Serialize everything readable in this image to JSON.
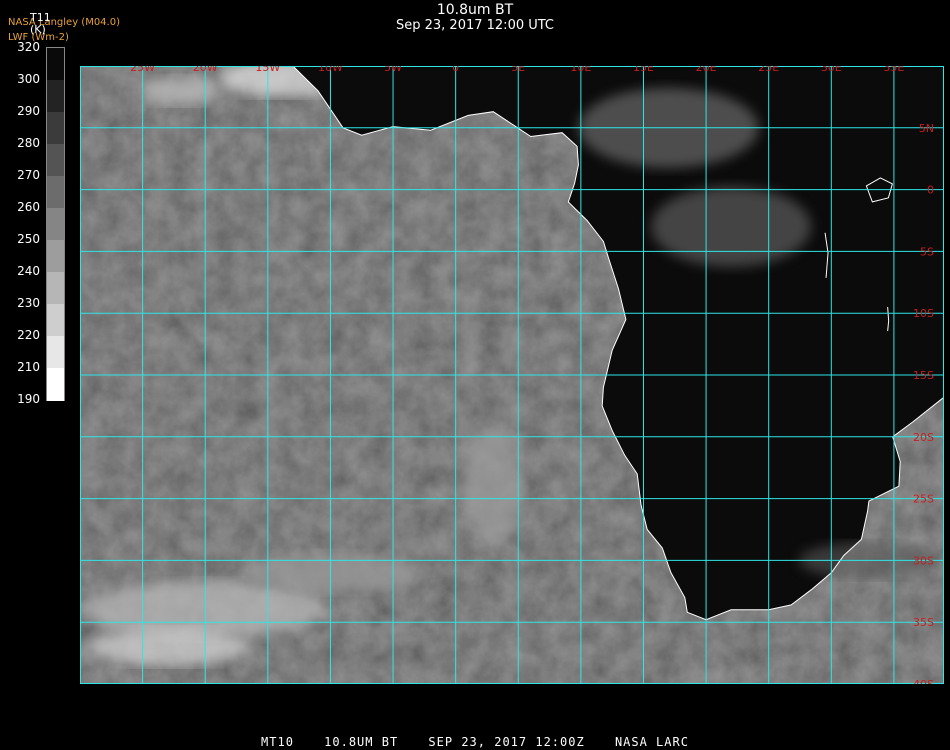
{
  "header": {
    "title": "10.8um BT",
    "subtitle": "Sep 23, 2017 12:00 UTC",
    "credit_line1": "NASA Langley (M04.0)",
    "credit_line2": "LWF (Wm-2)"
  },
  "colorbar": {
    "title": "T11",
    "unit": "(K)",
    "ticks": [
      "320",
      "300",
      "290",
      "280",
      "270",
      "260",
      "250",
      "240",
      "230",
      "220",
      "210",
      "190"
    ],
    "range": [
      190,
      320
    ],
    "colors": {
      "warm": "#000000",
      "cold": "#ffffff"
    }
  },
  "map": {
    "longitude_labels": [
      "25W",
      "20W",
      "15W",
      "10W",
      "5W",
      "0",
      "5E",
      "10E",
      "15E",
      "20E",
      "25E",
      "30E",
      "35E"
    ],
    "latitude_labels": [
      "5N",
      "0",
      "5S",
      "10S",
      "15S",
      "20S",
      "25S",
      "30S",
      "35S",
      "40S"
    ],
    "grid_color": "#2ee6e6",
    "label_color": "#c81e1e",
    "coast_color": "#ffffff",
    "extent": {
      "west": -30,
      "east": 39,
      "north": 10,
      "south": -40
    }
  },
  "footer": {
    "satellite": "MT10",
    "channel": "10.8UM BT",
    "datetime": "SEP 23, 2017 12:00Z",
    "source": "NASA LARC"
  }
}
